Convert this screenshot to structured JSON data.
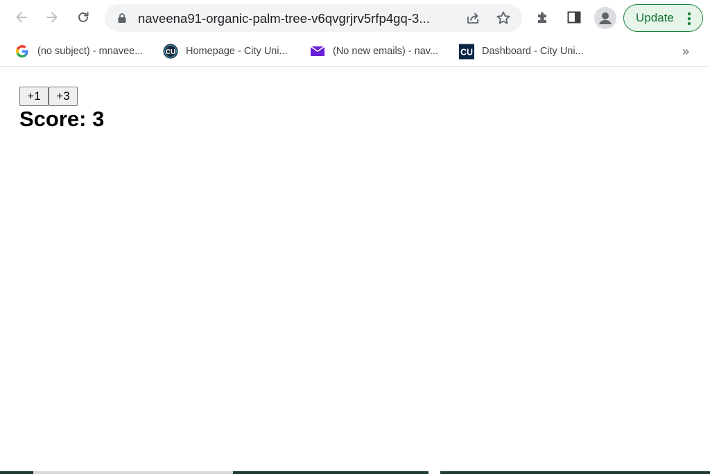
{
  "toolbar": {
    "back_icon": "arrow-left-icon",
    "forward_icon": "arrow-right-icon",
    "reload_icon": "reload-icon",
    "url": "naveena91-organic-palm-tree-v6qvgrjrv5rfp4gq-3...",
    "update_label": "Update"
  },
  "bookmarks": [
    {
      "label": "(no subject) - mnavee...",
      "icon": "google-icon"
    },
    {
      "label": "Homepage - City Uni...",
      "icon": "cu-circle-icon"
    },
    {
      "label": "(No new emails) - nav...",
      "icon": "mail-icon"
    },
    {
      "label": "Dashboard - City Uni...",
      "icon": "cu-square-icon"
    }
  ],
  "bookmarks_more": "»",
  "page": {
    "buttons": [
      "+1",
      "+3"
    ],
    "score_label": "Score:",
    "score_value": "3"
  },
  "colors": {
    "update_accent": "#188038",
    "mail_icon": "#6a1fd8",
    "cu_square": "#0b2545"
  }
}
